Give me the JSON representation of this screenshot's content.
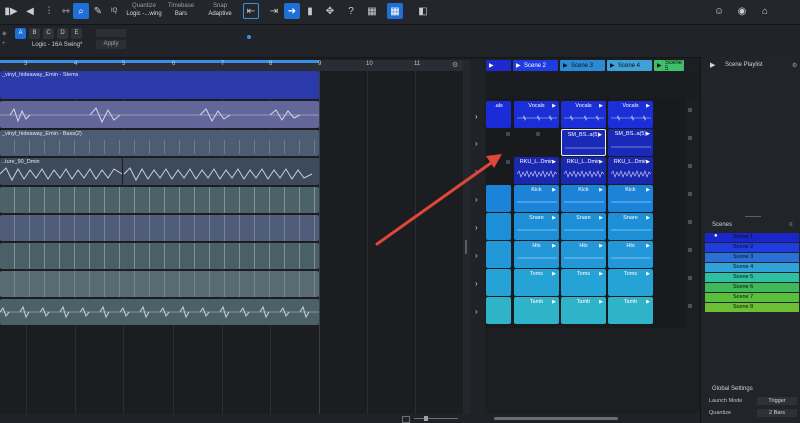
{
  "toolbar": {
    "quantize_label": "Quantize",
    "quantize_value": "Logic -...wing",
    "timebase_label": "Timebase",
    "timebase_value": "Bars",
    "snap_label": "Snap",
    "snap_value": "Adaptive",
    "iq_label": "IQ",
    "user_icon": "user-icon",
    "help_icon": "help-icon",
    "home_icon": "home-icon"
  },
  "groove": {
    "letters": [
      "A",
      "B",
      "C",
      "D",
      "E"
    ],
    "preset_value": "Logic - 16A Swing*",
    "apply_label": "Apply"
  },
  "ruler": {
    "ticks": [
      "3",
      "4",
      "5",
      "6",
      "7",
      "8",
      "9",
      "10",
      "11"
    ]
  },
  "arrange": {
    "tracks": [
      {
        "name": "_vinyl_hideaway_Emin - Stems",
        "color": "#2b3a9c"
      },
      {
        "name": "",
        "color": "#5a5f9e"
      },
      {
        "name": "_vinyl_hideaway_Emin - Bass(2)",
        "color": "#4d5a70"
      },
      {
        "name": "..ture_90_Dmin",
        "color": "#3b4b5a"
      },
      {
        "name": "",
        "color": "#4a6268"
      },
      {
        "name": "",
        "color": "#4f5d7a"
      },
      {
        "name": "",
        "color": "#4a6066"
      },
      {
        "name": "",
        "color": "#576b70"
      },
      {
        "name": "",
        "color": "#4c6068"
      }
    ]
  },
  "scenes_header": [
    {
      "name": "Scene 2",
      "color": "#1f3ce0"
    },
    {
      "name": "Scene 3",
      "color": "#2d8ad6"
    },
    {
      "name": "Scene 4",
      "color": "#40a0d8"
    },
    {
      "name": "Scene 5",
      "color": "#3fbf6a"
    }
  ],
  "clips": {
    "vocals_partial": ".als",
    "vocals": "Vocals",
    "bass": "SM_BS..a(5)",
    "keys": "RKU_L..Dmin",
    "kick": "Kick",
    "snare": "Snare",
    "hits": "Hts",
    "toms": "Toms",
    "tamb": "Tamb"
  },
  "playlist": {
    "title": "Scene Playlist",
    "scenes_label": "Scenes",
    "scenes": [
      {
        "name": "Scene 1",
        "color": "#1a27c8"
      },
      {
        "name": "Scene 2",
        "color": "#1f3ce0"
      },
      {
        "name": "Scene 3",
        "color": "#2b6fd6"
      },
      {
        "name": "Scene 4",
        "color": "#2fa3d8"
      },
      {
        "name": "Scene 5",
        "color": "#2fbfa3"
      },
      {
        "name": "Scene 6",
        "color": "#3fb85a"
      },
      {
        "name": "Scene 7",
        "color": "#5abf3a"
      },
      {
        "name": "Scene 8",
        "color": "#6cbf34"
      }
    ],
    "global_settings_label": "Global Settings",
    "launch_mode_label": "Launch Mode",
    "launch_mode_value": "Trigger",
    "quantize_label": "Quantize",
    "quantize_value": "2 Bars"
  },
  "annotation": {
    "arrow_color": "#e0463a"
  }
}
